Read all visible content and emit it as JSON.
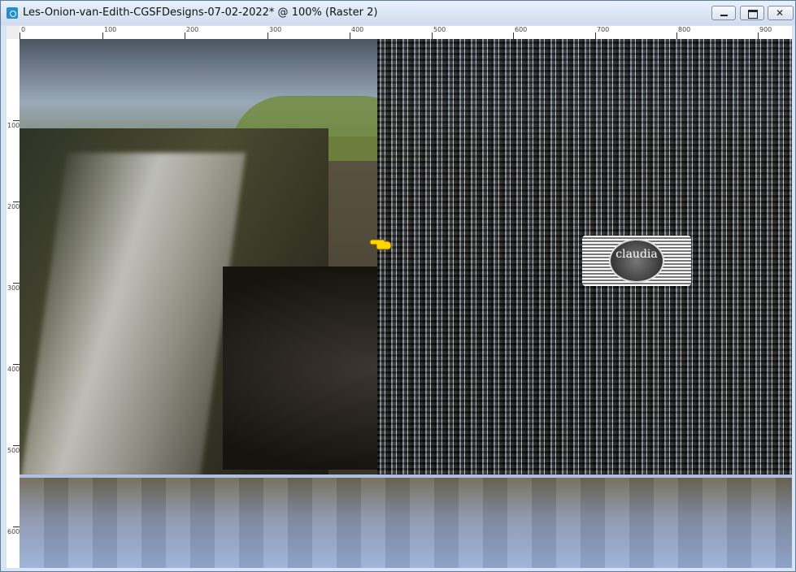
{
  "window": {
    "title": "Les-Onion-van-Edith-CGSFDesigns-07-02-2022* @ 100% (Raster 2)",
    "controls": [
      "minimize-icon",
      "maximize-icon",
      "close-icon"
    ],
    "close_glyph": "✕"
  },
  "ruler": {
    "horizontal_labels": [
      "0",
      "100",
      "200",
      "300",
      "400",
      "500",
      "600",
      "700",
      "800",
      "900"
    ],
    "vertical_labels": [
      "100",
      "200",
      "300",
      "400",
      "500",
      "600"
    ]
  },
  "canvas": {
    "watermark_text": "claudia",
    "pointer_icon": "pointing-hand-icon",
    "accent_color": "#1f8fd6"
  }
}
